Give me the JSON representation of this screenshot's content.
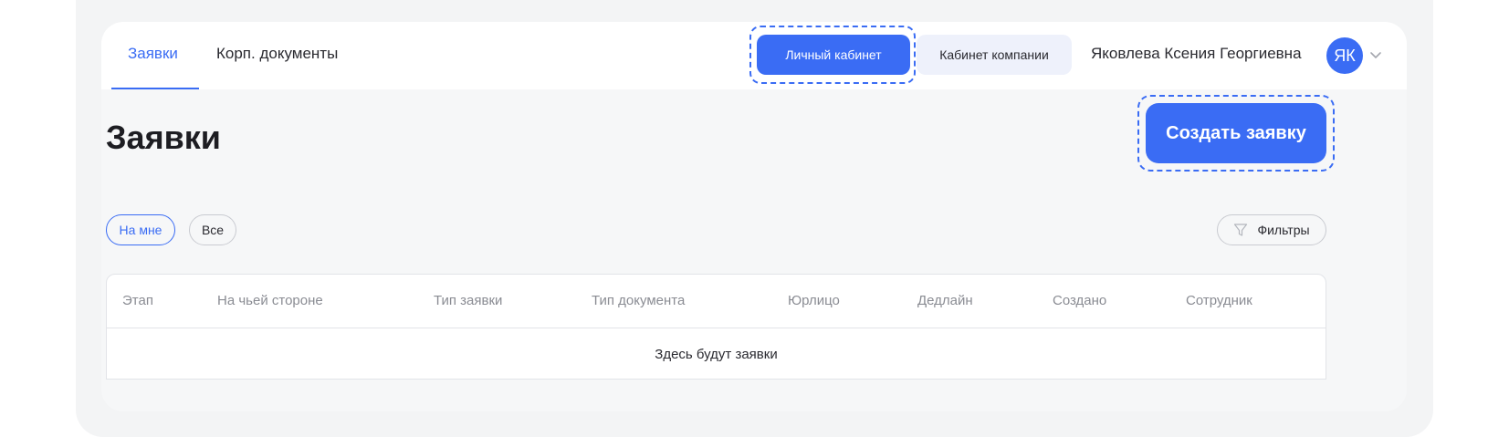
{
  "topnav": {
    "tabs": [
      {
        "label": "Заявки",
        "active": true
      },
      {
        "label": "Корп. документы",
        "active": false
      }
    ],
    "personal_cabinet_label": "Личный кабинет",
    "company_cabinet_label": "Кабинет компании",
    "user_name": "Яковлева Ксения Георгиевна",
    "avatar_initials": "ЯК"
  },
  "page": {
    "title": "Заявки",
    "create_button_label": "Создать заявку"
  },
  "filters": {
    "chips": [
      {
        "label": "На мне",
        "selected": true
      },
      {
        "label": "Все",
        "selected": false
      }
    ],
    "filters_button_label": "Фильтры"
  },
  "table": {
    "columns": [
      "Этап",
      "На чьей стороне",
      "Тип заявки",
      "Тип документа",
      "Юрлицо",
      "Дедлайн",
      "Создано",
      "Сотрудник"
    ],
    "empty_message": "Здесь будут заявки"
  },
  "colors": {
    "accent": "#3a6cf4",
    "background": "#f3f4f5",
    "card_background": "#f6f7f8"
  },
  "icons": {
    "filter": "filter-funnel-icon",
    "chevron": "chevron-down-icon"
  }
}
